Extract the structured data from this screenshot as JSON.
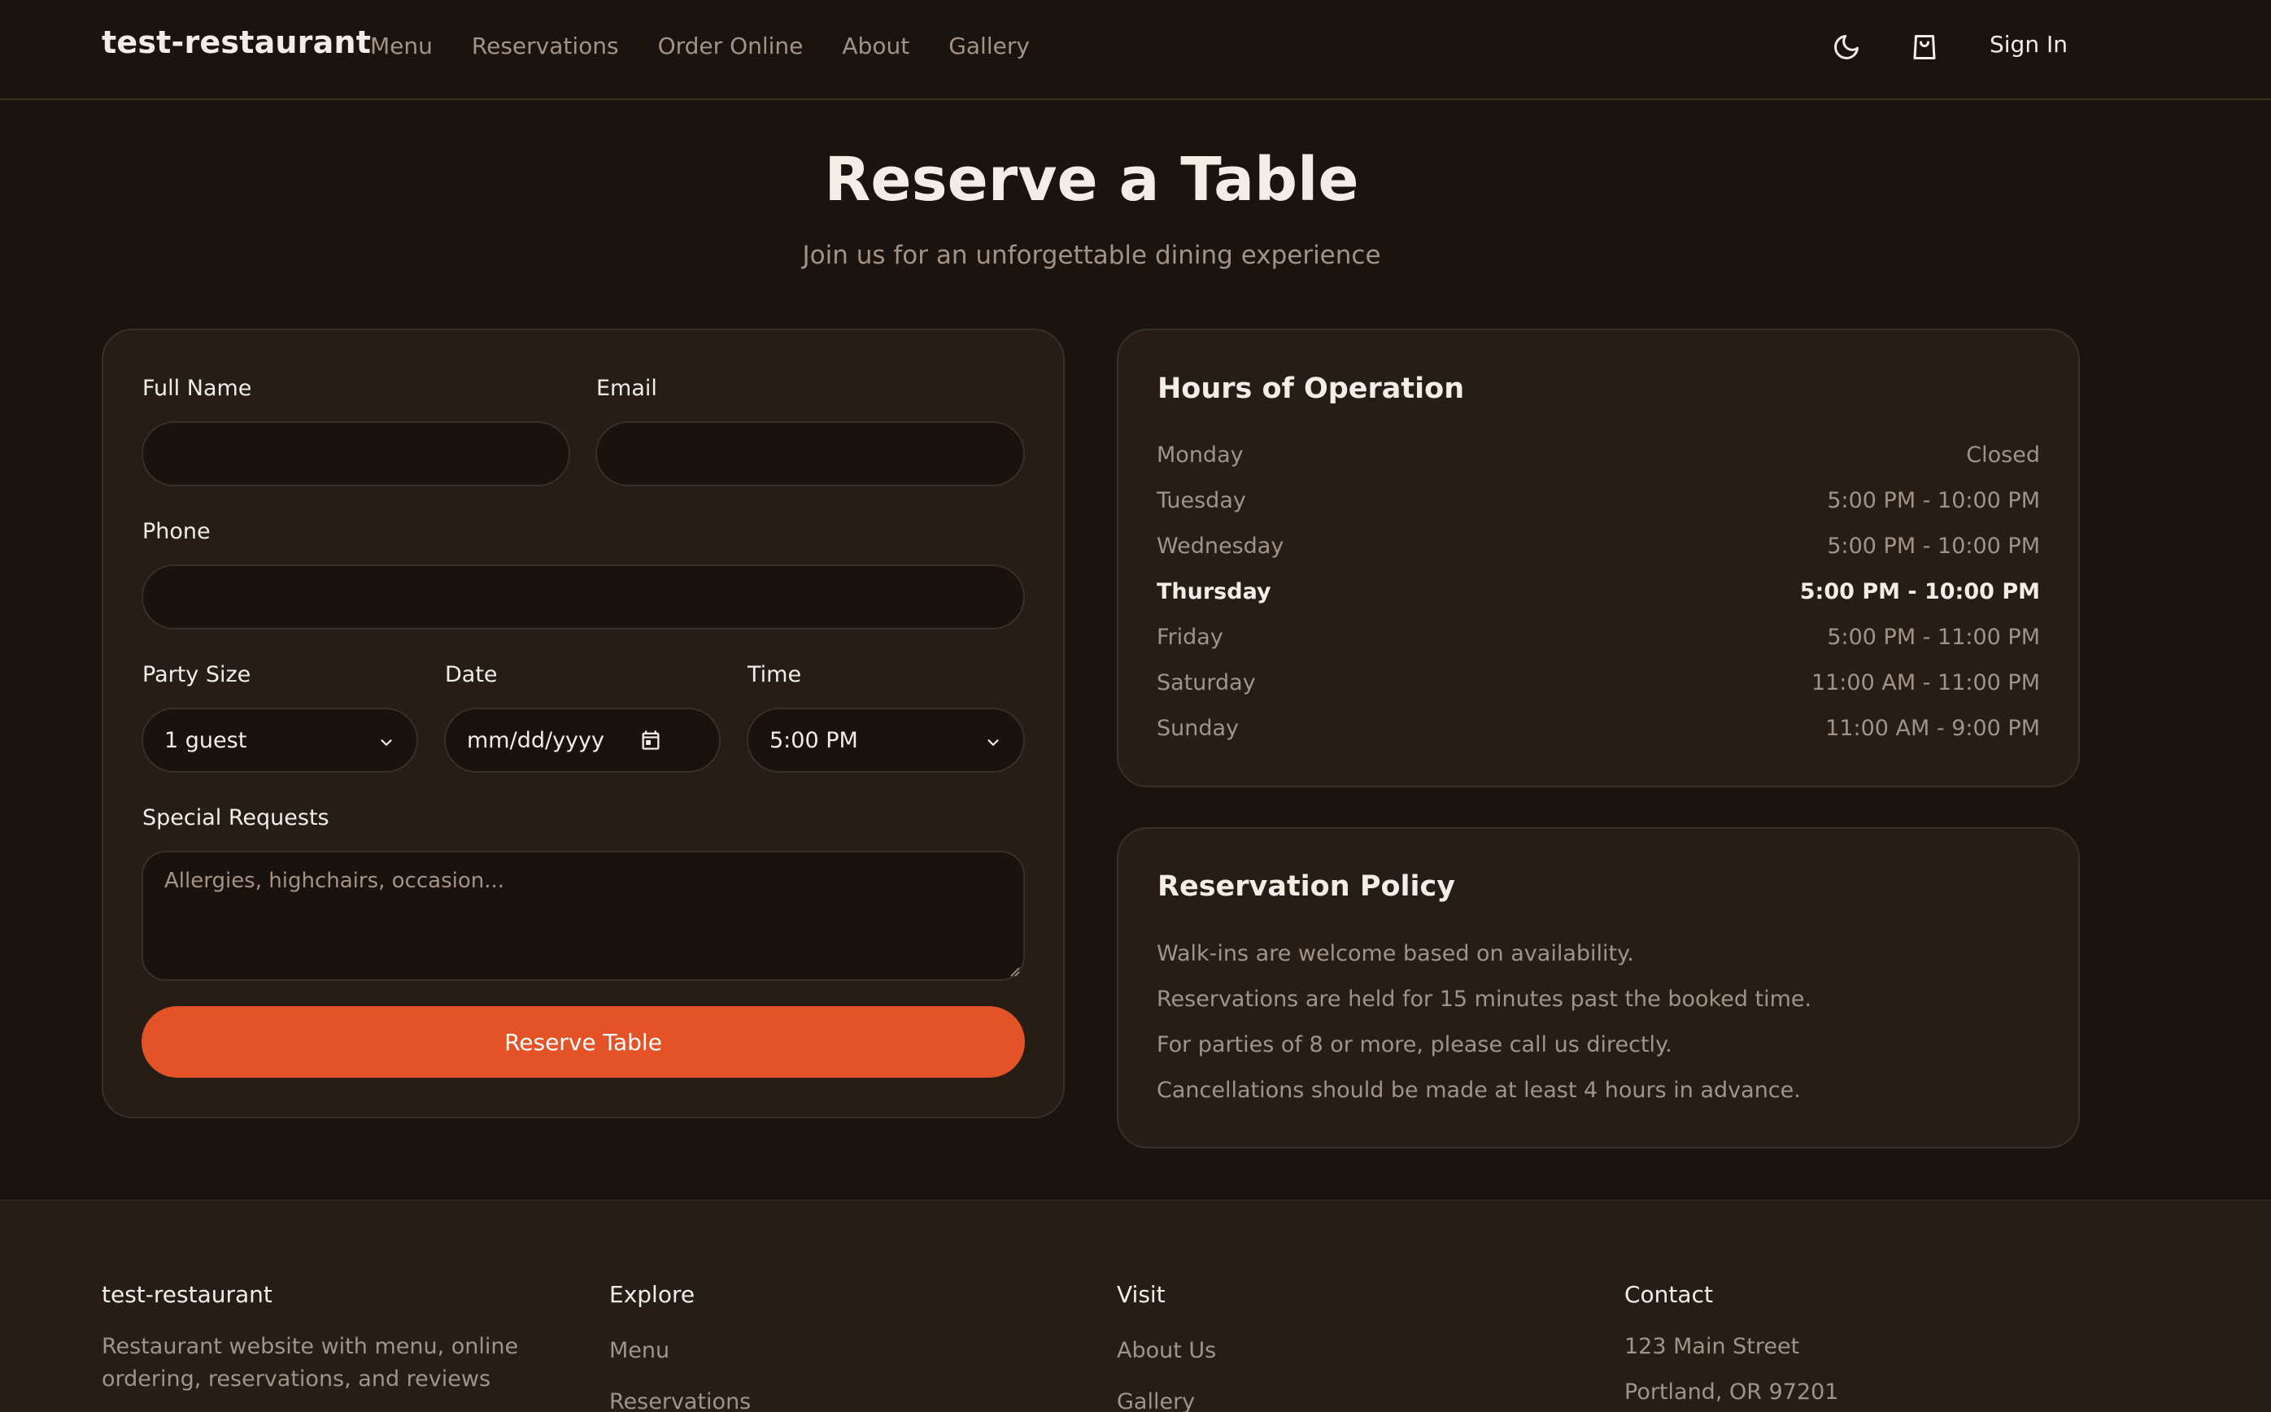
{
  "header": {
    "brand": "test-restaurant",
    "nav": [
      "Menu",
      "Reservations",
      "Order Online",
      "About",
      "Gallery"
    ],
    "theme_icon": "moon-icon",
    "cart_icon": "shopping-bag-icon",
    "sign_in": "Sign In"
  },
  "hero": {
    "title": "Reserve a Table",
    "subtitle": "Join us for an unforgettable dining experience"
  },
  "form": {
    "full_name_label": "Full Name",
    "full_name_value": "",
    "email_label": "Email",
    "email_value": "",
    "phone_label": "Phone",
    "phone_value": "",
    "party_size_label": "Party Size",
    "party_size_value": "1 guest",
    "date_label": "Date",
    "date_value": "mm/dd/yyyy",
    "time_label": "Time",
    "time_value": "5:00 PM",
    "special_label": "Special Requests",
    "special_placeholder": "Allergies, highchairs, occasion...",
    "submit": "Reserve Table"
  },
  "hours": {
    "title": "Hours of Operation",
    "rows": [
      {
        "day": "Monday",
        "time": "Closed"
      },
      {
        "day": "Tuesday",
        "time": "5:00 PM - 10:00 PM"
      },
      {
        "day": "Wednesday",
        "time": "5:00 PM - 10:00 PM"
      },
      {
        "day": "Thursday",
        "time": "5:00 PM - 10:00 PM"
      },
      {
        "day": "Friday",
        "time": "5:00 PM - 11:00 PM"
      },
      {
        "day": "Saturday",
        "time": "11:00 AM - 11:00 PM"
      },
      {
        "day": "Sunday",
        "time": "11:00 AM - 9:00 PM"
      }
    ],
    "current_day": "Thursday"
  },
  "policy": {
    "title": "Reservation Policy",
    "lines": [
      "Walk-ins are welcome based on availability.",
      "Reservations are held for 15 minutes past the booked time.",
      "For parties of 8 or more, please call us directly.",
      "Cancellations should be made at least 4 hours in advance."
    ]
  },
  "footer": {
    "brand": "test-restaurant",
    "description": [
      "Restaurant website with menu, online",
      "ordering, reservations, and reviews"
    ],
    "explore_title": "Explore",
    "explore_links": [
      "Menu",
      "Reservations"
    ],
    "visit_title": "Visit",
    "visit_links": [
      "About Us",
      "Gallery"
    ],
    "contact_title": "Contact",
    "contact_lines": [
      "123 Main Street",
      "Portland, OR 97201"
    ]
  },
  "colors": {
    "background": "#1b130e",
    "panel": "#261d16",
    "accent": "#e45327",
    "text": "#f4ede6",
    "muted": "#a39386"
  }
}
